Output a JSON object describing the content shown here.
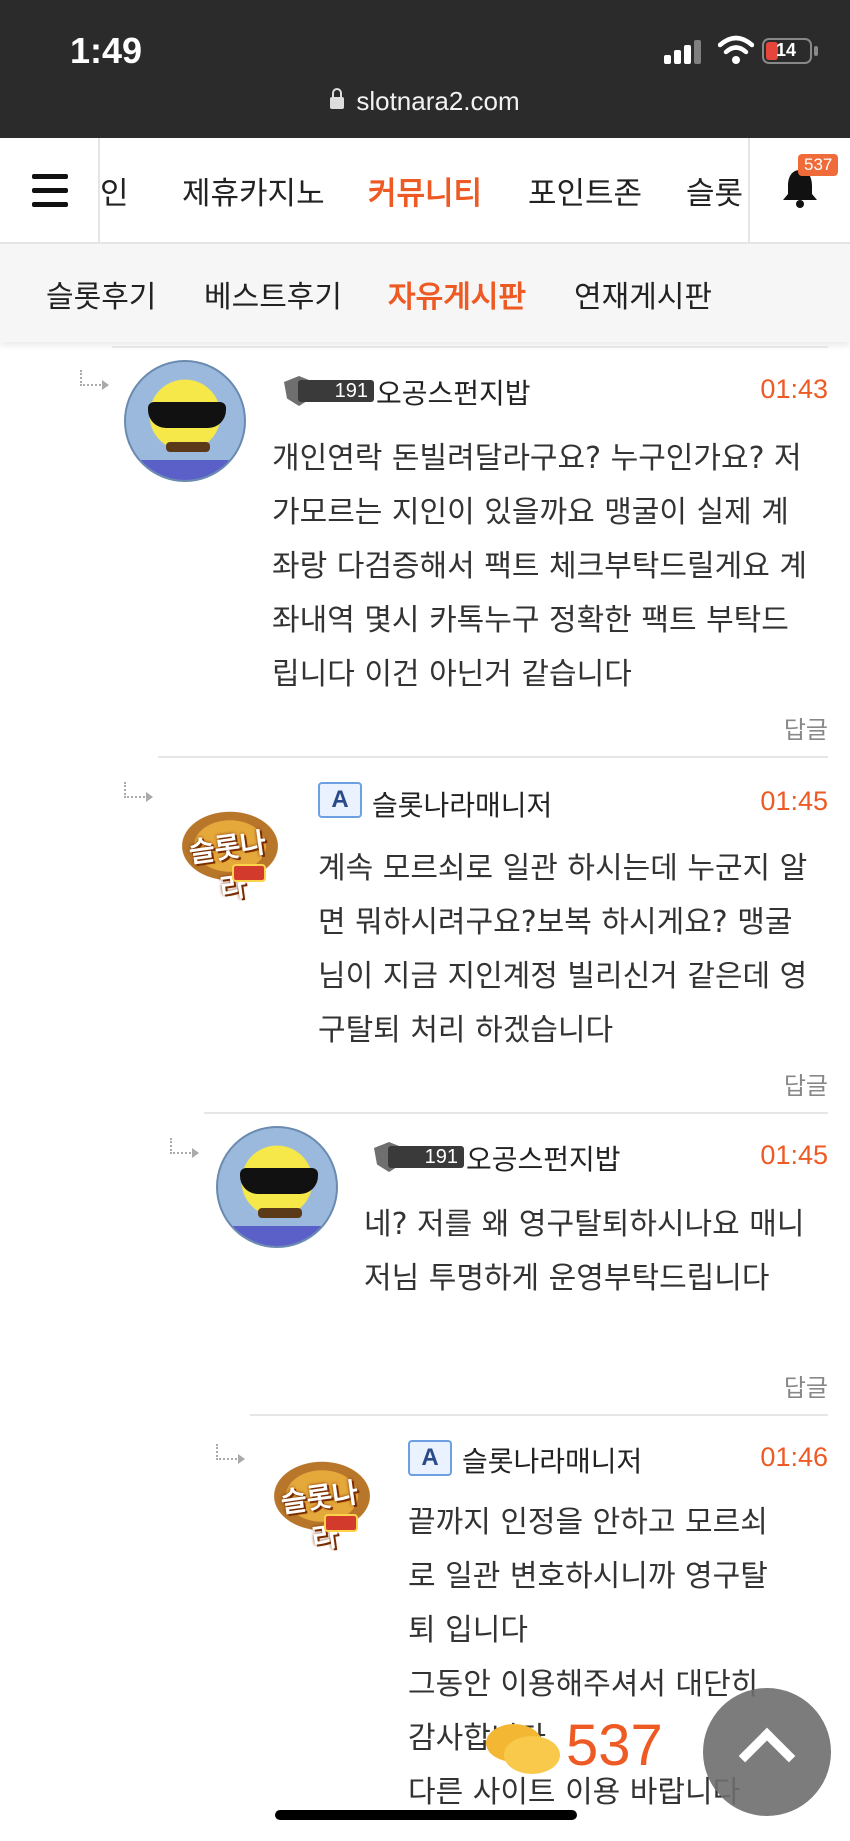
{
  "status_bar": {
    "time": "1:49",
    "battery": "14",
    "url": "slotnara2.com"
  },
  "main_nav": {
    "tabs": [
      "인",
      "제휴카지노",
      "커뮤니티",
      "포인트존",
      "슬롯"
    ],
    "active": "커뮤니티",
    "notification_count": "537"
  },
  "sub_nav": {
    "tabs": [
      "슬롯후기",
      "베스트후기",
      "자유게시판",
      "연재게시판"
    ],
    "active": "자유게시판"
  },
  "comments": [
    {
      "user": "오공스펀지밥",
      "level": "191",
      "time": "01:43",
      "text": "개인연락 돈빌려달라구요? 누구인가요? 저가모르는 지인이 있을까요 맹굴이 실제 계좌랑 다검증해서 팩트 체크부탁드릴게요 계좌내역 몇시 카톡누구 정확한 팩트 부탁드립니다 이건 아닌거 같습니다",
      "reply": "답글"
    },
    {
      "user": "슬롯나라매니저",
      "admin_badge": "A",
      "time": "01:45",
      "text": "계속 모르쇠로 일관 하시는데 누군지 알면 뭐하시려구요?보복 하시게요? 맹굴님이 지금 지인계정 빌리신거 같은데 영구탈퇴 처리 하겠습니다",
      "reply": "답글"
    },
    {
      "user": "오공스펀지밥",
      "level": "191",
      "time": "01:45",
      "text": "네? 저를 왜 영구탈퇴하시나요 매니저님 투명하게 운영부탁드립니다",
      "reply": "답글"
    },
    {
      "user": "슬롯나라매니저",
      "admin_badge": "A",
      "time": "01:46",
      "text_lines": [
        "끝까지 인정을 안하고 모르쇠로 일관 변호하시니까 영구탈퇴 입니다",
        "그동안 이용해주셔서 대단히 감사합니다",
        "다른 사이트 이용 바랍니다"
      ]
    }
  ],
  "logo_text": "슬롯나라",
  "floating": {
    "chat_count": "537"
  }
}
